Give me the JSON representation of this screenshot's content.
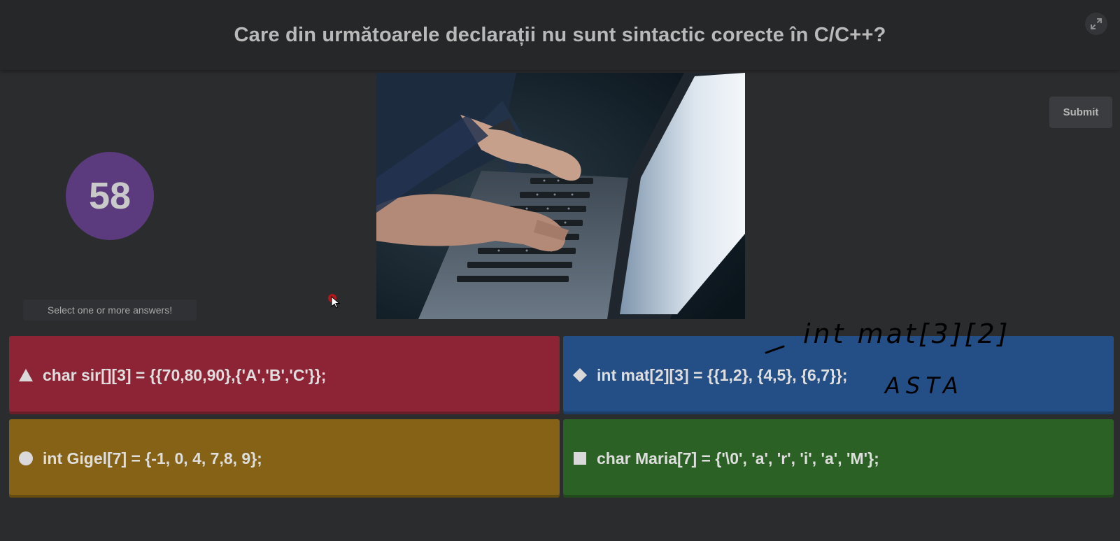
{
  "question": "Care din următoarele declarații nu sunt sintactic corecte în C/C++?",
  "timer": "58",
  "submit_label": "Submit",
  "hint": "Select one or more answers!",
  "answers": [
    {
      "shape": "triangle-icon",
      "color": "#8c2436",
      "text": "char sir[][3] = {{70,80,90},{'A','B','C'}};"
    },
    {
      "shape": "diamond-icon",
      "color": "#244f86",
      "text": "int mat[2][3] = {{1,2}, {4,5}, {6,7}};"
    },
    {
      "shape": "circle-icon",
      "color": "#856216",
      "text": "int Gigel[7] = {-1, 0, 4, 7,8, 9};"
    },
    {
      "shape": "square-icon",
      "color": "#2b6124",
      "text": "char Maria[7] = {'\\0', 'a', 'r', 'i', 'a', 'M'};"
    }
  ],
  "annotation": {
    "line1": "int mat[3][2]",
    "line2": "ASTA"
  },
  "icons": {
    "fullscreen": "expand-icon",
    "cursor": "mouse-pointer-icon"
  },
  "colors": {
    "background": "#2b2c2e",
    "timer": "#5c3a7e"
  }
}
